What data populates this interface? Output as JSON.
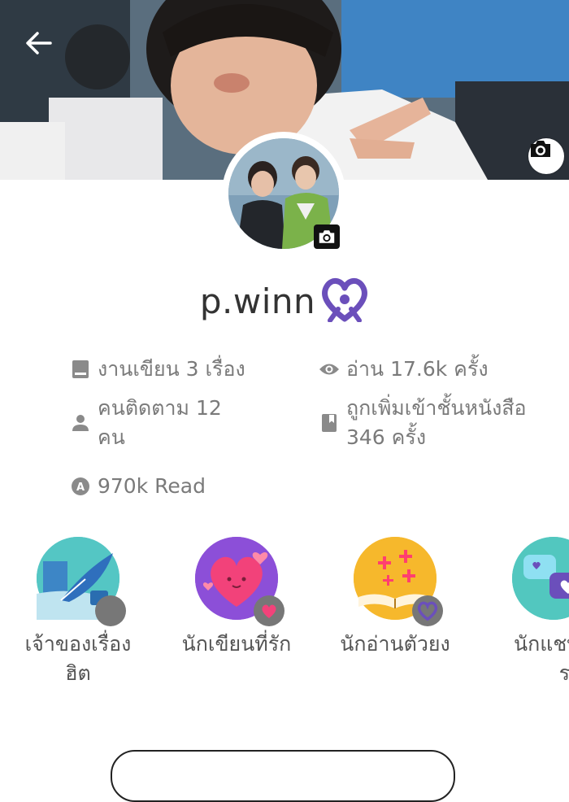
{
  "header": {
    "back_icon": "arrow-left-icon",
    "cover_camera_icon": "camera-icon",
    "avatar_camera_icon": "camera-icon"
  },
  "profile": {
    "username": "p.winn",
    "badge_icon": "purple-heart-ribbon-icon"
  },
  "stats": {
    "works": "งานเขียน 3 เรื่อง",
    "reads": "อ่าน 17.6k ครั้ง",
    "followers_line1": "คนติดตาม 12",
    "followers_line2": "คน",
    "library_line1": "ถูกเพิ่มเข้าชั้นหนังสือ",
    "library_line2": "346 ครั้ง",
    "read_total": "970k Read"
  },
  "achievements": [
    {
      "line1": "เจ้าของเรื่อง",
      "line2": "ฮิต",
      "icon": "quill-icon"
    },
    {
      "line1": "นักเขียนที่รัก",
      "line2": "",
      "icon": "heart-icon"
    },
    {
      "line1": "นักอ่านตัวยง",
      "line2": "",
      "icon": "open-book-icon"
    },
    {
      "line1": "นักแชทต",
      "line2": "รนด",
      "icon": "chat-bubble-icon"
    }
  ],
  "colors": {
    "accent_purple": "#6b4fbb",
    "text_gray": "#7a7a7a"
  }
}
